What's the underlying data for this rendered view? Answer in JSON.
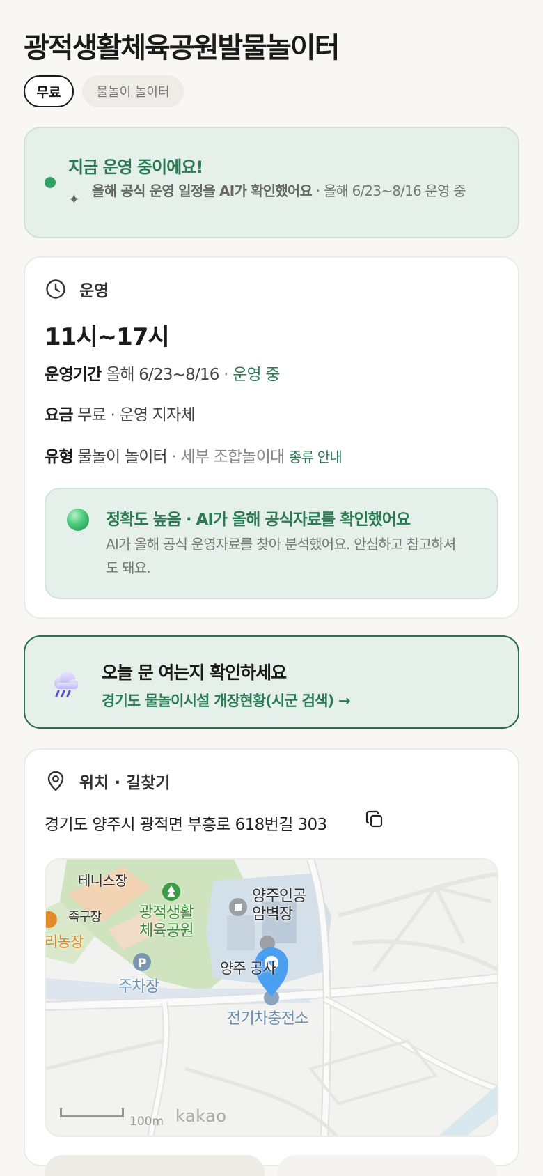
{
  "page": {
    "title": "광적생활체육공원발물놀이터",
    "chips": {
      "free": "무료",
      "type": "물놀이 놀이터"
    }
  },
  "status": {
    "title": "지금 운영 중이에요!",
    "ai_note_bold": "올해 공식 운영 일정을 AI가 확인했어요",
    "ai_note_rest": " · 올해 6/23~8/16 운영 중",
    "dot_color": "#2f9e63"
  },
  "operation": {
    "section_title": "운영",
    "hours": "11시~17시",
    "period_label": "운영기간",
    "period_value": "올해 6/23~8/16",
    "period_sep": " · ",
    "period_status": "운영 중",
    "fee_label": "요금",
    "fee_value": "무료 · 운영 지자체",
    "type_label": "유형",
    "type_value": "물놀이 놀이터",
    "type_detail": " · 세부 조합놀이대",
    "type_link": "종류 안내",
    "accuracy_title": "정확도 높음 · AI가 올해 공식자료를 확인했어요",
    "accuracy_text": "AI가 올해 공식 운영자료를 찾아 분석했어요. 안심하고 참고하셔도 돼요."
  },
  "open_check": {
    "title": "오늘 문 여는지 확인하세요",
    "link": "경기도 물놀이시설 개장현황(시군 검색) →",
    "icon": "rain-cloud-icon"
  },
  "location": {
    "section_title": "위치 · 길찾기",
    "address": "경기도 양주시 광적면 부흥로 618번길 303",
    "map": {
      "labels": {
        "tennis": "테니스장",
        "jokgu": "족구장",
        "park_line1": "광적생활",
        "park_line2": "체육공원",
        "farm": "리농장",
        "parking": "주차장",
        "climbing_line1": "양주인공",
        "climbing_line2": "암벽장",
        "office": "양주   공사",
        "ev": "전기차충전소"
      },
      "scale": "100m",
      "brand": "kakao",
      "pin_color": "#4a9ff0"
    }
  },
  "colors": {
    "accent_green": "#2b7a53",
    "status_bg": "#e6f0ea"
  }
}
